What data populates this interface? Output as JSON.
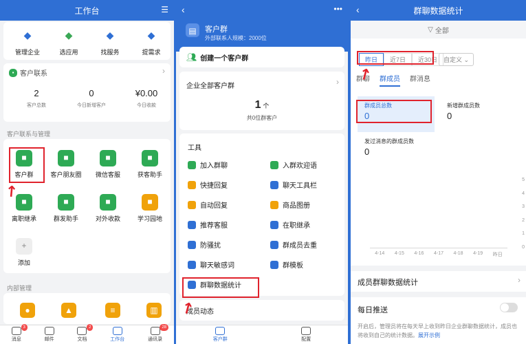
{
  "workbench": {
    "title": "工作台",
    "top_items": [
      {
        "label": "管理企业",
        "icon": "hexagon-icon",
        "color": "#2f6fd4"
      },
      {
        "label": "选应用",
        "icon": "apps-icon",
        "color": "#3aa856"
      },
      {
        "label": "找服务",
        "icon": "tie-icon",
        "color": "#2f6fd4"
      },
      {
        "label": "提需求",
        "icon": "shapes-icon",
        "color": "#2f6fd4"
      }
    ],
    "contacts_title": "客户联系",
    "stats": [
      {
        "value": "2",
        "label": "客户总数"
      },
      {
        "value": "0",
        "label": "今日新增客户"
      },
      {
        "value": "¥0.00",
        "label": "今日收款"
      }
    ],
    "section_title": "客户联系与管理",
    "apps": [
      {
        "label": "客户群",
        "icon": "group-icon",
        "color": "#2eaa55"
      },
      {
        "label": "客户朋友圈",
        "icon": "aperture-icon",
        "color": "#2eaa55"
      },
      {
        "label": "微信客服",
        "icon": "chat-icon",
        "color": "#2eaa55"
      },
      {
        "label": "获客助手",
        "icon": "bolt-icon",
        "color": "#2eaa55"
      },
      {
        "label": "离职继承",
        "icon": "doc-icon",
        "color": "#2eaa55"
      },
      {
        "label": "群发助手",
        "icon": "megaphone-icon",
        "color": "#2eaa55"
      },
      {
        "label": "对外收款",
        "icon": "yen-icon",
        "color": "#2eaa55"
      },
      {
        "label": "学习园地",
        "icon": "planet-icon",
        "color": "#f0a20a"
      },
      {
        "label": "添加",
        "icon": "plus-icon",
        "color": "#eeeeee"
      }
    ],
    "internal_title": "内部管理",
    "tabs": [
      {
        "label": "消息",
        "badge": "3"
      },
      {
        "label": "邮件",
        "badge": ""
      },
      {
        "label": "文档",
        "badge": "2"
      },
      {
        "label": "工作台",
        "badge": ""
      },
      {
        "label": "通讯录",
        "badge": "28"
      }
    ]
  },
  "groups": {
    "title": "客户群",
    "subtitle": "外部联系人规模：2000位",
    "create_label": "创建一个客户群",
    "all_groups_label": "企业全部客户群",
    "count": "1",
    "count_unit": "个",
    "count_sub": "共0位群客户",
    "tools_title": "工具",
    "tools": [
      {
        "label": "加入群聊",
        "color": "#2eaa55"
      },
      {
        "label": "入群欢迎语",
        "color": "#2eaa55"
      },
      {
        "label": "快捷回复",
        "color": "#f0a20a"
      },
      {
        "label": "聊天工具栏",
        "color": "#2f6fd4"
      },
      {
        "label": "自动回复",
        "color": "#f0a20a"
      },
      {
        "label": "商品图册",
        "color": "#f0a20a"
      },
      {
        "label": "推荐客服",
        "color": "#2f6fd4"
      },
      {
        "label": "在职继承",
        "color": "#2f6fd4"
      },
      {
        "label": "防骚扰",
        "color": "#2f6fd4"
      },
      {
        "label": "群成员去重",
        "color": "#2f6fd4"
      },
      {
        "label": "聊天敏感词",
        "color": "#2f6fd4"
      },
      {
        "label": "群模板",
        "color": "#2f6fd4"
      },
      {
        "label": "群聊数据统计",
        "color": "#2f6fd4"
      }
    ],
    "dynamic_label": "成员动态",
    "tabs": [
      {
        "label": "客户群"
      },
      {
        "label": "配置"
      }
    ]
  },
  "stats": {
    "title": "群聊数据统计",
    "filter_label": "全部",
    "ranges": [
      "昨日",
      "近7日",
      "近30日"
    ],
    "custom_label": "自定义",
    "tabs": [
      "群聊",
      "群成员",
      "群消息"
    ],
    "metrics": [
      {
        "label": "群成员总数",
        "value": "0"
      },
      {
        "label": "新增群成员数",
        "value": "0"
      },
      {
        "label": "发过消息的群成员数",
        "value": "0"
      }
    ],
    "member_section": "成员群聊数据统计",
    "daily_push": "每日推送",
    "push_note": "开启后，管理员将在每天早上收到昨日企业群聊数据统计，成员也将收到自己的统计数据。",
    "push_link": "展开示例"
  },
  "chart_data": {
    "type": "bar",
    "categories": [
      "4-14",
      "4-15",
      "4-16",
      "4-17",
      "4-18",
      "4-19",
      "昨日"
    ],
    "values": [
      0,
      0,
      0,
      0,
      0,
      0,
      0
    ],
    "yticks": [
      "5",
      "4",
      "3",
      "2",
      "1",
      "0"
    ],
    "ylim": [
      0,
      5
    ]
  }
}
